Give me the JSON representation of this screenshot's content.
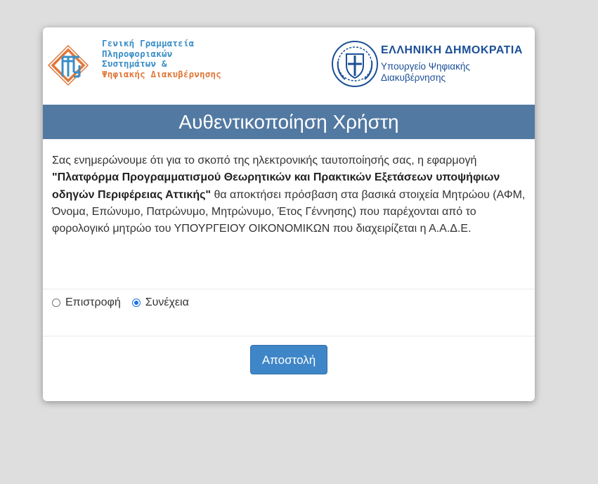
{
  "header": {
    "gsis_lines": [
      "Γενική Γραμματεία",
      "Πληροφοριακών",
      "Συστημάτων &",
      "Ψηφιακής Διακυβέρνησης"
    ],
    "gov_title": "ΕΛΛΗΝΙΚΗ ΔΗΜΟΚΡΑΤΙΑ",
    "gov_sub_1": "Υπουργείο Ψηφιακής",
    "gov_sub_2": "Διακυβέρνησης"
  },
  "title": "Αυθεντικοποίηση Χρήστη",
  "message": {
    "intro": "Σας ενημερώνουμε ότι για το σκοπό της ηλεκτρονικής ταυτοποίησής σας, η εφαρμογή ",
    "app_name": "\"Πλατφόρμα Προγραμματισμού Θεωρητικών και Πρακτικών Εξετάσεων υποψήφιων οδηγών Περιφέρειας Αττικής\"",
    "rest": " θα αποκτήσει πρόσβαση στα βασικά στοιχεία Μητρώου (ΑΦΜ, Όνομα, Επώνυμο, Πατρώνυμο, Μητρώνυμο, Έτος Γέννησης) που παρέχονται από το φορολογικό μητρώο του ΥΠΟΥΡΓΕΙΟΥ ΟΙΚΟΝΟΜΙΚΩΝ που διαχειρίζεται η Α.Α.Δ.Ε."
  },
  "options": {
    "back_label": "Επιστροφή",
    "continue_label": "Συνέχεια",
    "selected": "continue"
  },
  "submit_label": "Αποστολή",
  "colors": {
    "title_bar": "#5279a2",
    "button": "#3f86c8",
    "gsis_blue": "#3a8ec7",
    "gsis_orange": "#e0783a",
    "gov_blue": "#1b4f97"
  }
}
